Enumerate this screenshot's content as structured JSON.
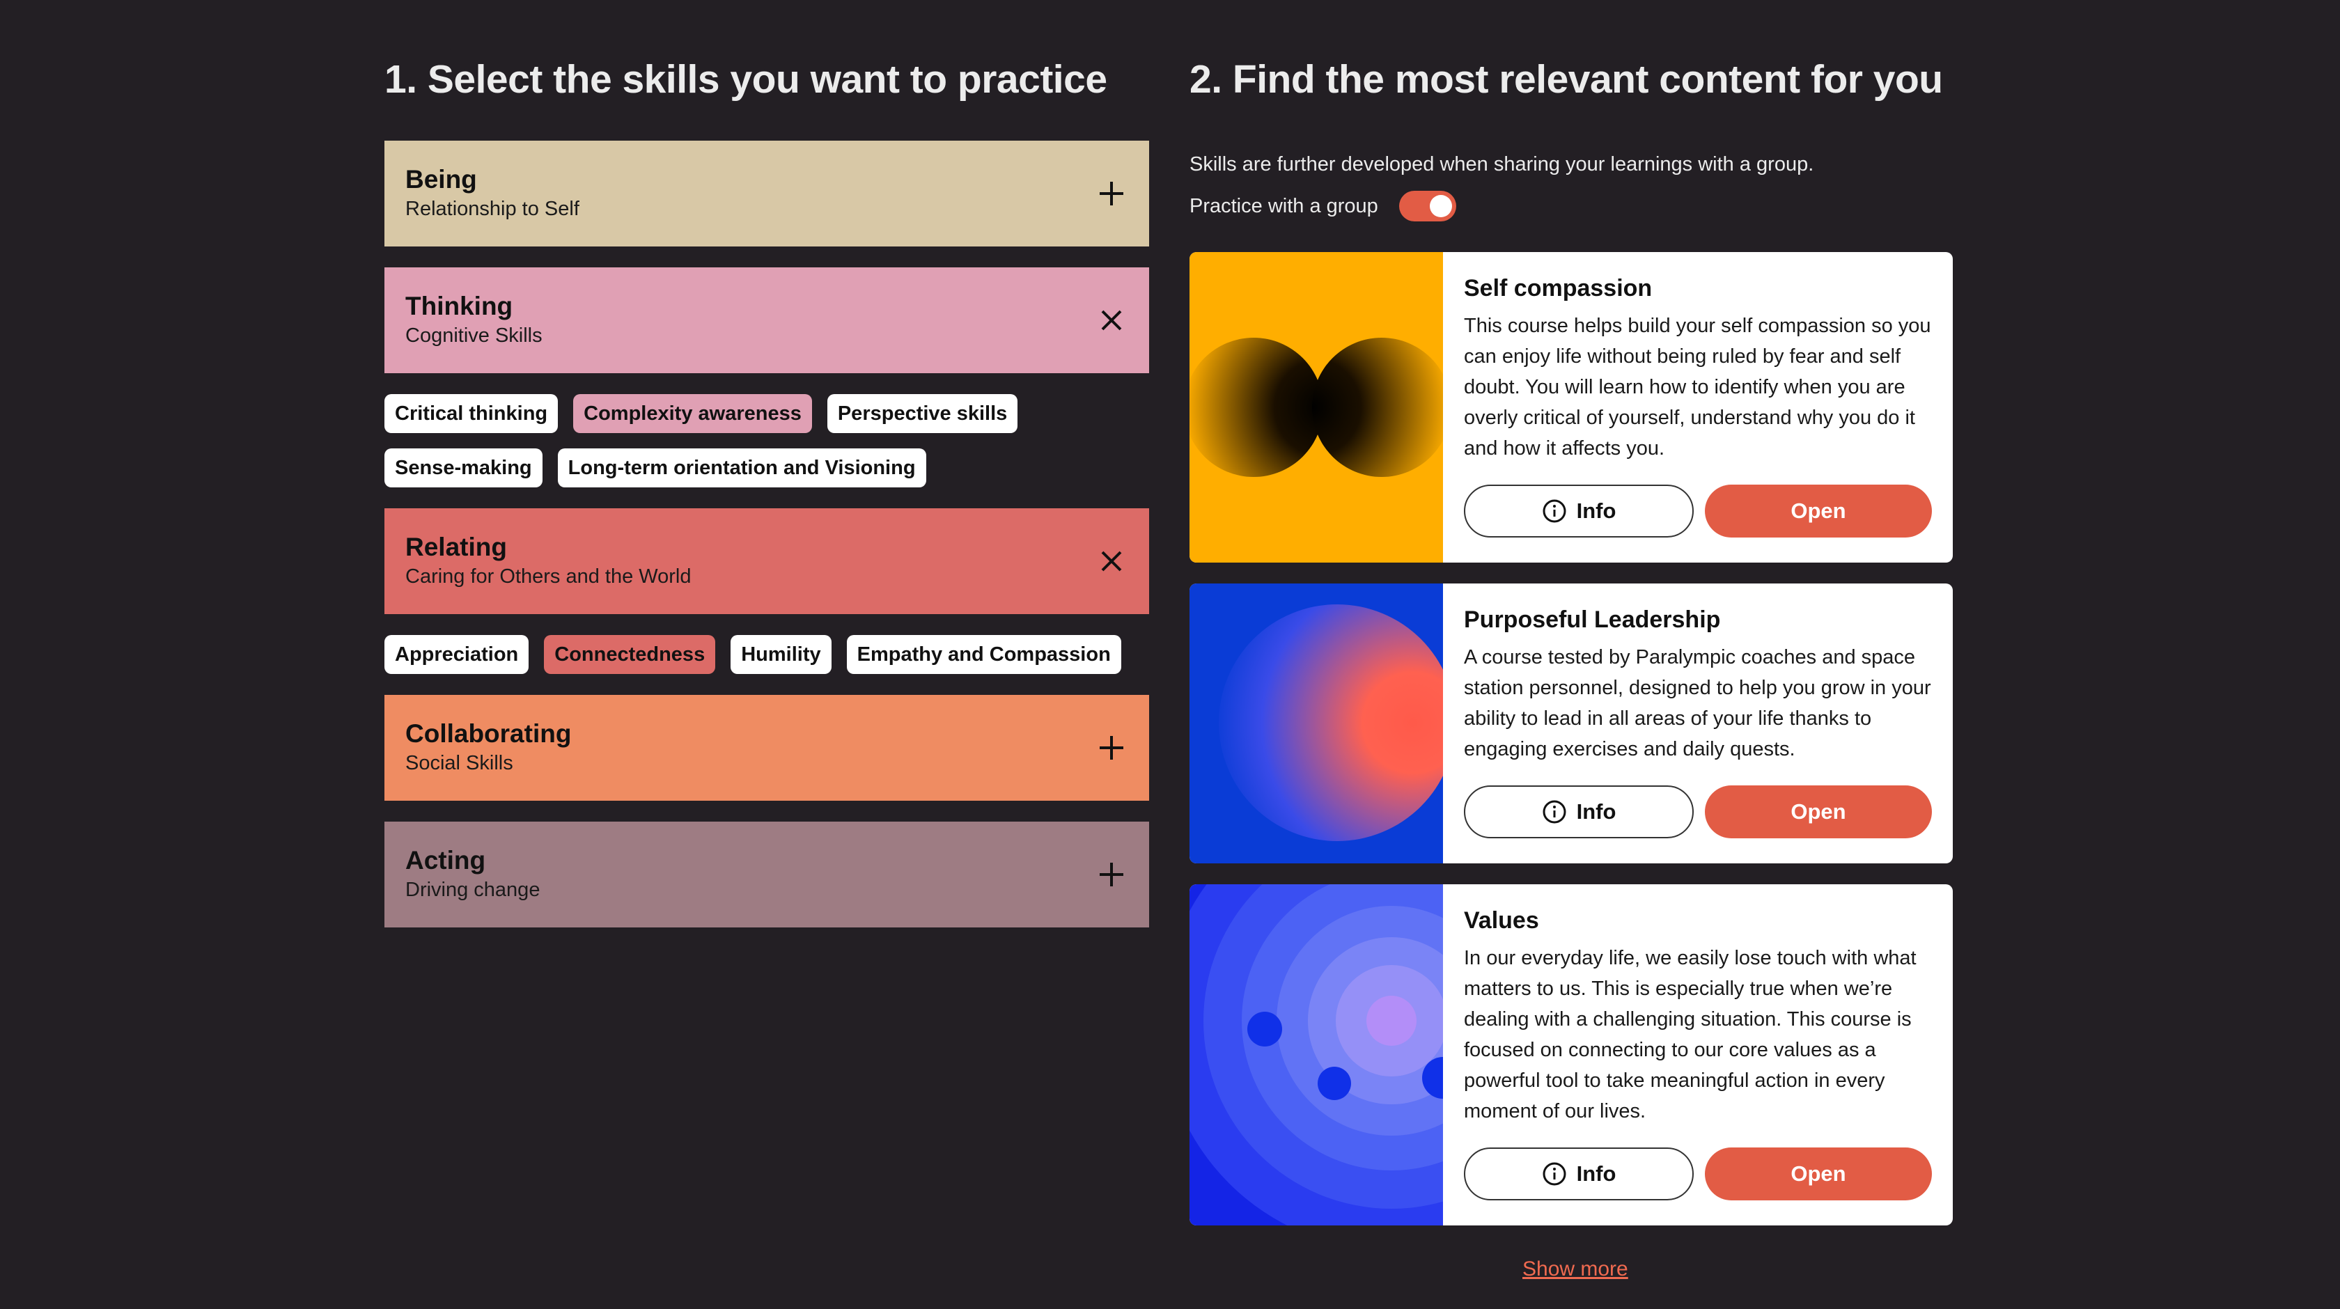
{
  "left": {
    "heading": "1. Select the skills you want to practice",
    "categories": [
      {
        "title": "Being",
        "subtitle": "Relationship to Self",
        "color": "#d8c8a6",
        "state": "collapsed"
      },
      {
        "title": "Thinking",
        "subtitle": "Cognitive Skills",
        "color": "#e0a0b4",
        "state": "expanded",
        "chips": [
          "Critical thinking",
          "Complexity awareness",
          "Perspective skills",
          "Sense-making",
          "Long-term orientation and Visioning"
        ],
        "selected": [
          "Complexity awareness"
        ]
      },
      {
        "title": "Relating",
        "subtitle": "Caring for Others and the World",
        "color": "#dc6b67",
        "state": "expanded",
        "chips": [
          "Appreciation",
          "Connectedness",
          "Humility",
          "Empathy and Compassion"
        ],
        "selected": [
          "Connectedness"
        ]
      },
      {
        "title": "Collaborating",
        "subtitle": "Social Skills",
        "color": "#ef8c62",
        "state": "collapsed"
      },
      {
        "title": "Acting",
        "subtitle": "Driving change",
        "color": "#9e7c83",
        "state": "collapsed"
      }
    ]
  },
  "right": {
    "heading": "2. Find the most relevant content for you",
    "intro": "Skills are further developed when sharing your learnings with a group.",
    "group_label": "Practice with a group",
    "group_toggle_on": true,
    "accent": "#e25c45",
    "cards": [
      {
        "title": "Self compassion",
        "description": "This course helps build your self compassion so you can enjoy life without being ruled by fear and self doubt. You will learn how to identify when you are overly critical of yourself, understand why you do it and how it affects you.",
        "info_label": "Info",
        "open_label": "Open"
      },
      {
        "title": "Purposeful Leadership",
        "description": "A course tested by Paralympic coaches and space station personnel, designed to help you grow in your ability to lead in all areas of your life thanks to engaging exercises and daily quests.",
        "info_label": "Info",
        "open_label": "Open"
      },
      {
        "title": "Values",
        "description": "In our everyday life, we easily lose touch with what matters to us. This is especially true when we’re dealing with a challenging situation. This course is focused on connecting to our core values as a powerful tool to take meaningful action in every moment of our lives.",
        "info_label": "Info",
        "open_label": "Open"
      }
    ],
    "show_more": "Show more"
  }
}
